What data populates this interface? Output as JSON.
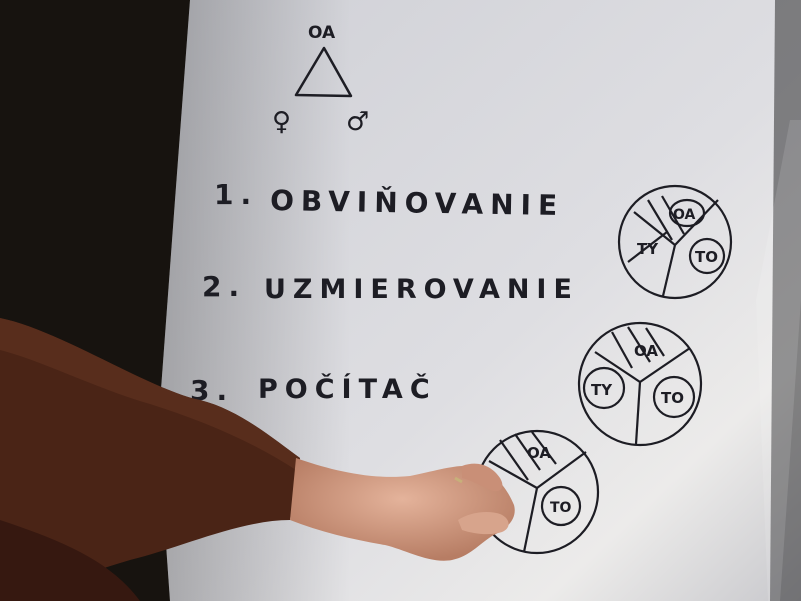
{
  "board": {
    "triangle": {
      "top_label": "OA",
      "left_symbol": "♀",
      "right_symbol": "♂"
    },
    "items": [
      {
        "num": "1.",
        "text": "OBVIŇOVANIE"
      },
      {
        "num": "2.",
        "text": "UZMIEROVANIE"
      },
      {
        "num": "3.",
        "text": "POČÍTAČ"
      }
    ],
    "circles": [
      {
        "labels": [
          "OA",
          "TY",
          "TO"
        ]
      },
      {
        "labels": [
          "OA",
          "TY",
          "TO"
        ]
      },
      {
        "labels": [
          "OA",
          "TO"
        ]
      }
    ]
  },
  "colors": {
    "paper": "#dcdce0",
    "ink": "#1d1d24",
    "sleeve": "#4a2416",
    "skin": "#d9a58c"
  }
}
